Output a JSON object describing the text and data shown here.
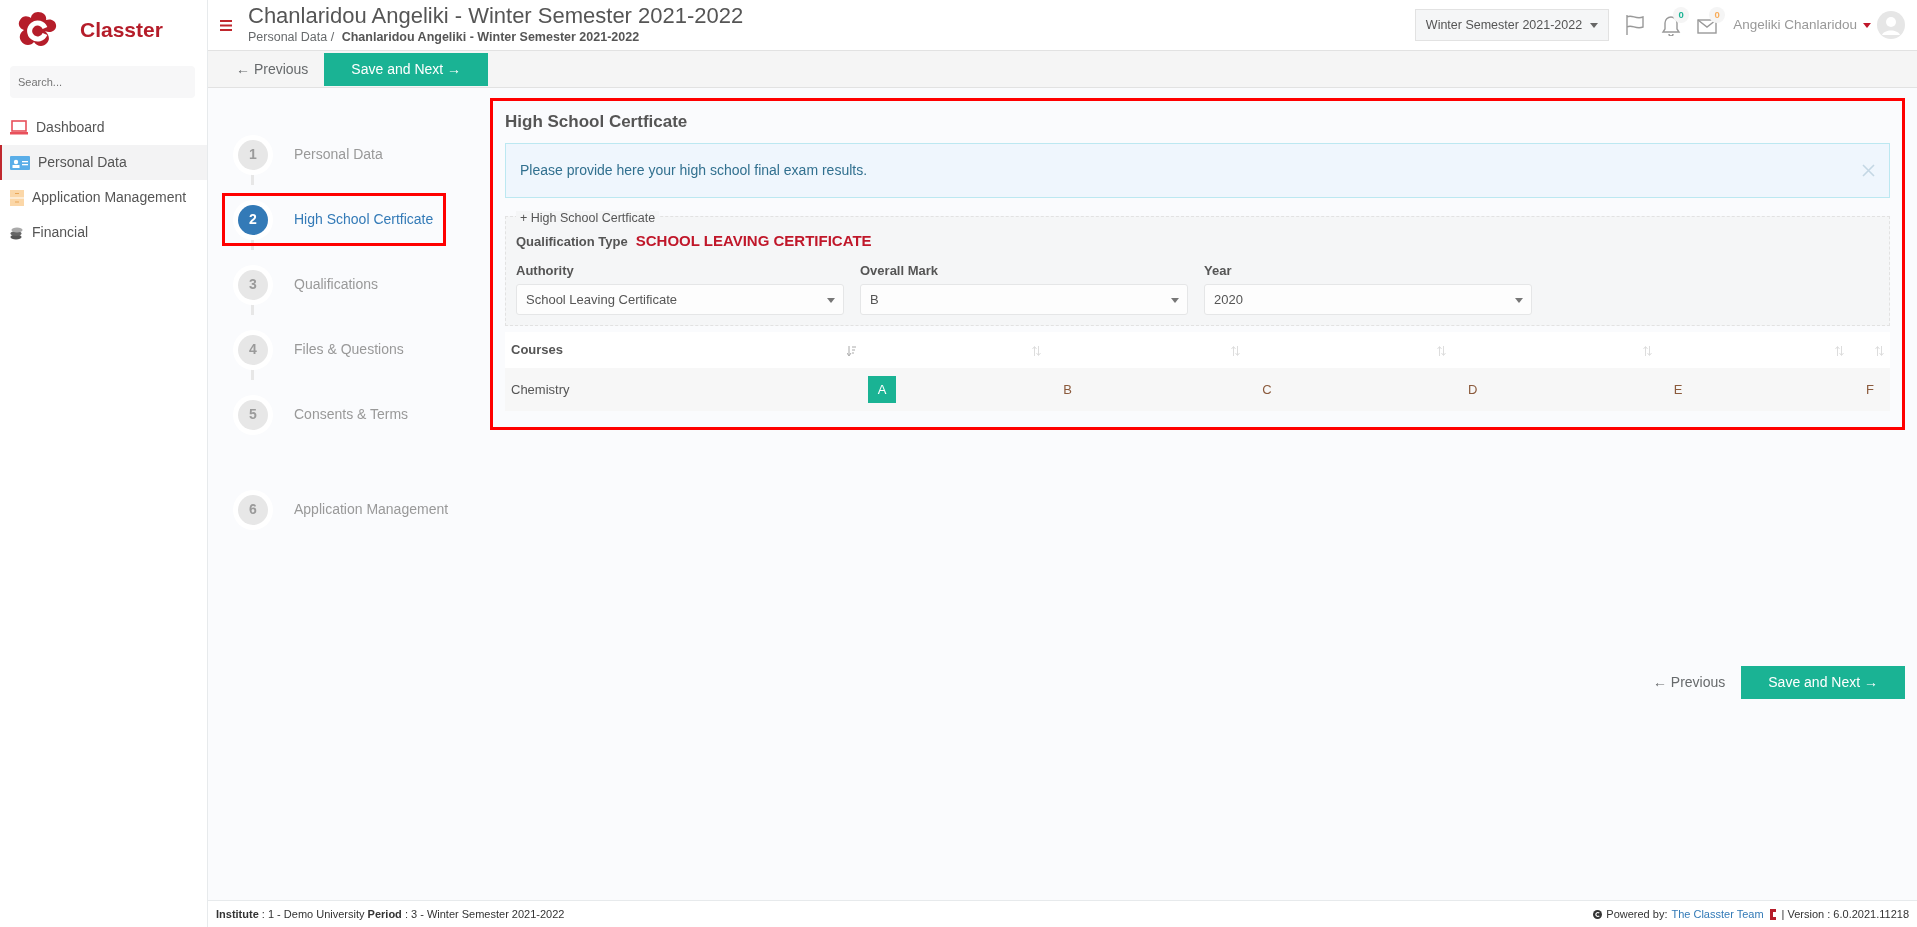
{
  "brand": {
    "name": "Classter"
  },
  "sidebar": {
    "search_placeholder": "Search...",
    "items": [
      {
        "label": "Dashboard",
        "selected": false
      },
      {
        "label": "Personal Data",
        "selected": true
      },
      {
        "label": "Application Management",
        "selected": false
      },
      {
        "label": "Financial",
        "selected": false
      }
    ]
  },
  "header": {
    "title": "Chanlaridou Angeliki - Winter Semester 2021-2022",
    "breadcrumb": [
      "Personal Data",
      "/",
      "Chanlaridou Angeliki - Winter Semester 2021-2022"
    ],
    "period": "Winter Semester 2021-2022",
    "badges": [
      {
        "count": "0",
        "color": "#1ab394"
      },
      {
        "count": "0",
        "color": "#f8ac59"
      }
    ],
    "user": "Angeliki Chanlaridou"
  },
  "toolbar": {
    "previous": "← Previous",
    "next": "Save and Next →"
  },
  "steps": [
    {
      "number": "1",
      "label": "Personal Data",
      "selected": false,
      "highlighted": false
    },
    {
      "number": "2",
      "label": "High School Certficate",
      "selected": true,
      "highlighted": true
    },
    {
      "number": "3",
      "label": "Qualifications",
      "selected": false,
      "highlighted": false
    },
    {
      "number": "4",
      "label": "Files & Questions",
      "selected": false,
      "highlighted": false
    },
    {
      "number": "5",
      "label": "Consents & Terms",
      "selected": false,
      "highlighted": false
    },
    {
      "number": "6",
      "label": "Application Management",
      "selected": false,
      "highlighted": false
    }
  ],
  "panel": {
    "highlighted": true,
    "title": "High School Certficate",
    "alert": "Please provide here your high school final exam results.",
    "legend": "+ High School Certficate",
    "qualification_label": "Qualification Type",
    "qualification_value": "SCHOOL LEAVING CERTIFICATE",
    "fields": [
      {
        "label": "Authority",
        "value": "School Leaving Certificate"
      },
      {
        "label": "Overall Mark",
        "value": "B"
      },
      {
        "label": "Year",
        "value": "2020"
      }
    ],
    "table": {
      "columns": [
        {
          "label": "Courses",
          "sorted": true
        },
        {
          "sorted": false
        },
        {
          "sorted": false
        },
        {
          "sorted": false
        },
        {
          "sorted": false
        },
        {
          "sorted": false
        },
        {
          "sorted": false
        }
      ],
      "rows": [
        {
          "course": "Chemistry",
          "grades": [
            {
              "label": "A",
              "selected": true
            },
            {
              "label": "B",
              "selected": false
            },
            {
              "label": "C",
              "selected": false
            },
            {
              "label": "D",
              "selected": false
            },
            {
              "label": "E",
              "selected": false
            },
            {
              "label": "F",
              "selected": false
            }
          ]
        }
      ]
    }
  },
  "bottom": {
    "previous": "← Previous",
    "next": "Save and Next →"
  },
  "footer": {
    "info": "**Institute** : 1 - Demo University **Period** : 3 - Winter Semester 2021-2022",
    "powered": "Powered by:",
    "team": "The Classter Team",
    "version": "| Version : 6.0.2021.11218"
  }
}
